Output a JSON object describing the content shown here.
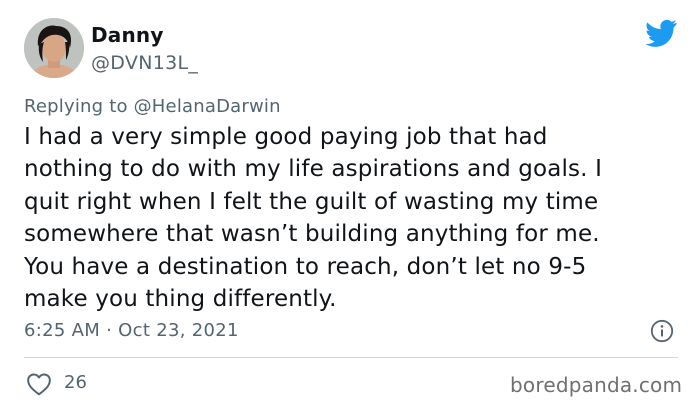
{
  "user": {
    "display_name": "Danny",
    "handle": "@DVN13L_",
    "avatar_icon": "user-avatar-photo"
  },
  "brand": {
    "icon": "twitter-bird-icon",
    "color": "#1d9bf0"
  },
  "reply": {
    "prefix": "Replying to",
    "mention": "@HelanaDarwin"
  },
  "tweet": {
    "text": "I had a very simple good paying job that had\nnothing to do with my life aspirations and goals. I\nquit right when I felt the guilt of wasting my time\nsomewhere that wasn’t building anything for me.\nYou have a destination to reach, don’t let no 9-5\nmake you thing differently."
  },
  "meta": {
    "timestamp": "6:25 AM · Oct 23, 2021",
    "info_icon": "info-icon"
  },
  "actions": {
    "like_icon": "heart-icon",
    "like_count": "26"
  },
  "watermark": {
    "text": "boredpanda.com"
  }
}
